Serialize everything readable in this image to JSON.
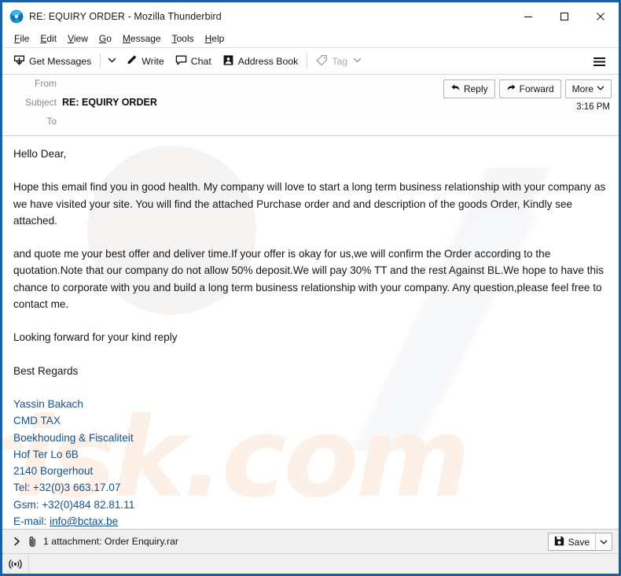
{
  "window": {
    "title": "RE: EQUIRY ORDER - Mozilla Thunderbird",
    "app_icon": "thunderbird-icon",
    "minimize_label": "Minimize",
    "maximize_label": "Maximize",
    "close_label": "Close",
    "border_color": "#1a5fa8"
  },
  "menubar": {
    "items": [
      {
        "label": "File",
        "accel": "F"
      },
      {
        "label": "Edit",
        "accel": "E"
      },
      {
        "label": "View",
        "accel": "V"
      },
      {
        "label": "Go",
        "accel": "G"
      },
      {
        "label": "Message",
        "accel": "M"
      },
      {
        "label": "Tools",
        "accel": "T"
      },
      {
        "label": "Help",
        "accel": "H"
      }
    ]
  },
  "toolbar": {
    "get_messages": "Get Messages",
    "write": "Write",
    "chat": "Chat",
    "address_book": "Address Book",
    "tag": "Tag",
    "tag_disabled": true,
    "menu_label": "Application menu"
  },
  "message_header": {
    "from_label": "From",
    "from_value": "",
    "subject_label": "Subject",
    "subject_value": "RE: EQUIRY ORDER",
    "to_label": "To",
    "to_value": "",
    "time": "3:16 PM",
    "actions": {
      "reply": "Reply",
      "forward": "Forward",
      "more": "More"
    }
  },
  "body": {
    "greeting": "Hello Dear,",
    "paragraph1": "Hope this email find you in good health. My company will love to start a long term business relationship with your company as we have visited your site. You will find the attached  Purchase order and  and description of the goods  Order, Kindly see attached.",
    "paragraph2": "and quote me your best offer and deliver time.If your offer is okay for us,we will confirm the Order according to the quotation.Note that our company do not allow 50% deposit.We will pay 30% TT and the rest Against BL.We hope to have this chance to corporate with  you and build a long term business relationship with your company. Any question,please feel free to contact me.",
    "closing": "Looking forward for your kind reply",
    "regards": "Best Regards",
    "signature": {
      "name": "Yassin Bakach",
      "company": "CMD TAX",
      "department": "Boekhouding & Fiscaliteit",
      "street": "Hof Ter Lo 6B",
      "city": "2140 Borgerhout",
      "tel": "Tel: +32(0)3 663.17.07",
      "gsm": "Gsm: +32(0)484 82.81.11",
      "email_label": "E-mail: ",
      "email": "info@bctax.be",
      "link_color": "#15538e"
    },
    "watermark_text": "risk.com"
  },
  "attachment_bar": {
    "expand_icon": "chevron-right-icon",
    "clip_icon": "paperclip-icon",
    "label": "1 attachment: Order Enquiry.rar",
    "save_label": "Save",
    "save_icon": "floppy-disk-icon"
  },
  "statusbar": {
    "icon": "broadcast-icon",
    "text": ""
  }
}
